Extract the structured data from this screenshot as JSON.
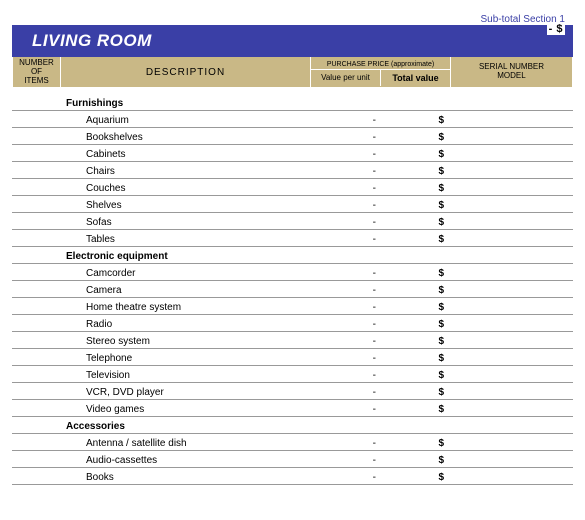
{
  "header": {
    "subtotal_label": "Sub-total Section 1",
    "subtotal_value": "-   $",
    "title": "LIVING ROOM"
  },
  "columns": {
    "num_items_l1": "NUMBER OF",
    "num_items_l2": "ITEMS",
    "description": "DESCRIPTION",
    "purchase_price": "PURCHASE PRICE (approximate)",
    "value_per_unit": "Value per unit",
    "total_value": "Total value",
    "serial_l1": "SERIAL NUMBER",
    "serial_l2": "MODEL"
  },
  "sections": [
    {
      "title": "Furnishings",
      "items": [
        {
          "desc": "Aquarium",
          "vpu": "-",
          "tv": "$"
        },
        {
          "desc": "Bookshelves",
          "vpu": "-",
          "tv": "$"
        },
        {
          "desc": "Cabinets",
          "vpu": "-",
          "tv": "$"
        },
        {
          "desc": "Chairs",
          "vpu": "-",
          "tv": "$"
        },
        {
          "desc": "Couches",
          "vpu": "-",
          "tv": "$"
        },
        {
          "desc": "Shelves",
          "vpu": "-",
          "tv": "$"
        },
        {
          "desc": "Sofas",
          "vpu": "-",
          "tv": "$"
        },
        {
          "desc": "Tables",
          "vpu": "-",
          "tv": "$"
        }
      ]
    },
    {
      "title": "Electronic equipment",
      "items": [
        {
          "desc": "Camcorder",
          "vpu": "-",
          "tv": "$"
        },
        {
          "desc": "Camera",
          "vpu": "-",
          "tv": "$"
        },
        {
          "desc": "Home theatre system",
          "vpu": "-",
          "tv": "$"
        },
        {
          "desc": "Radio",
          "vpu": "-",
          "tv": "$"
        },
        {
          "desc": "Stereo system",
          "vpu": "-",
          "tv": "$"
        },
        {
          "desc": "Telephone",
          "vpu": "-",
          "tv": "$"
        },
        {
          "desc": "Television",
          "vpu": "-",
          "tv": "$"
        },
        {
          "desc": "VCR, DVD player",
          "vpu": "-",
          "tv": "$"
        },
        {
          "desc": "Video games",
          "vpu": "-",
          "tv": "$"
        }
      ]
    },
    {
      "title": "Accessories",
      "items": [
        {
          "desc": "Antenna / satellite dish",
          "vpu": "-",
          "tv": "$"
        },
        {
          "desc": "Audio-cassettes",
          "vpu": "-",
          "tv": "$"
        },
        {
          "desc": "Books",
          "vpu": "-",
          "tv": "$"
        }
      ]
    }
  ]
}
